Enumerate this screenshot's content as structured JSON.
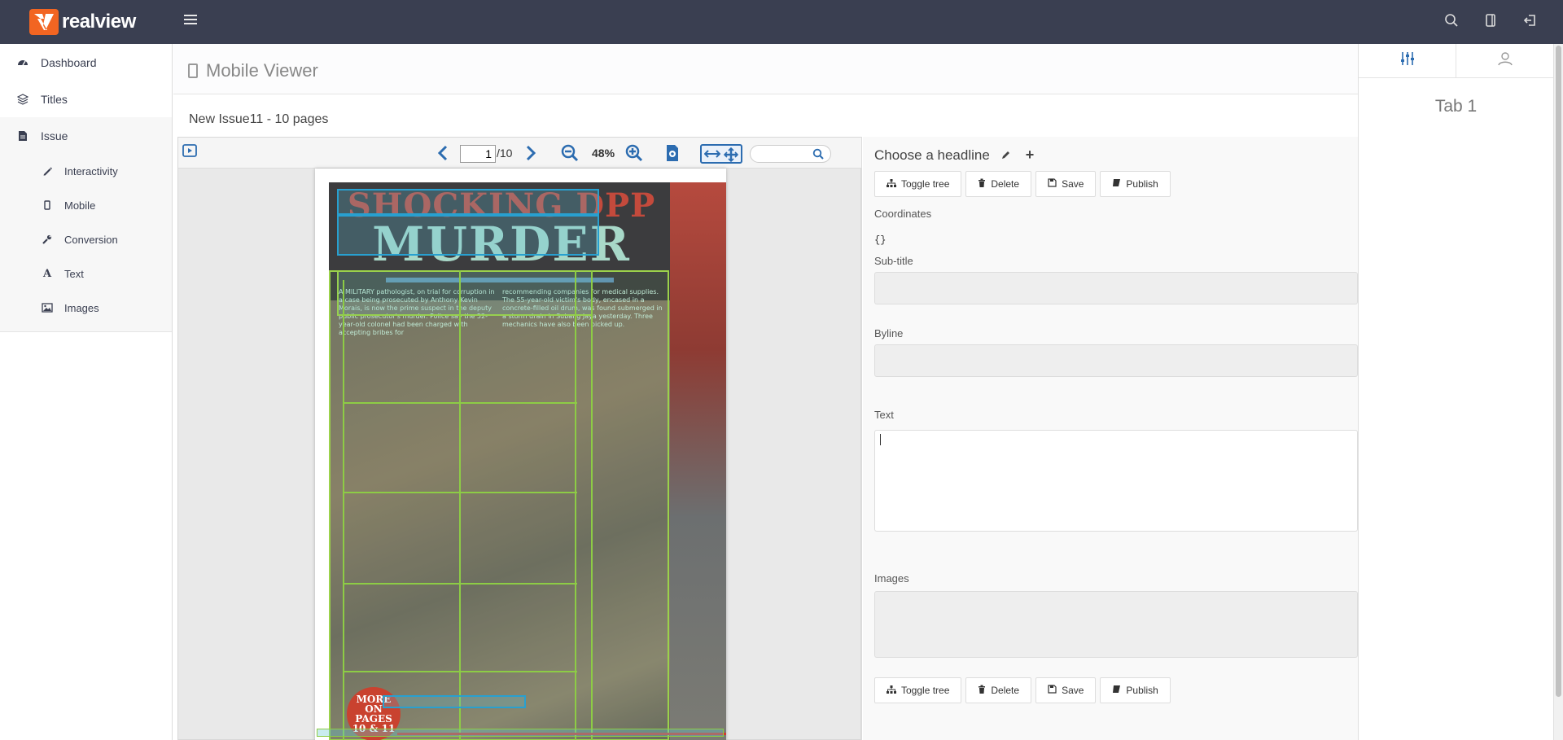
{
  "app": {
    "brand": "realview",
    "brand_color": "#f26522",
    "topbar_color": "#3a3f51"
  },
  "topbar": {
    "icons": [
      "menu-icon",
      "search-icon",
      "tablet-icon",
      "logout-icon"
    ]
  },
  "sidebar": {
    "items": [
      {
        "label": "Dashboard",
        "icon": "dashboard-icon"
      },
      {
        "label": "Titles",
        "icon": "layers-icon"
      },
      {
        "label": "Issue",
        "icon": "document-icon"
      }
    ],
    "sub_items": [
      {
        "label": "Interactivity",
        "icon": "pen-icon"
      },
      {
        "label": "Mobile",
        "icon": "mobile-icon"
      },
      {
        "label": "Conversion",
        "icon": "wrench-icon"
      },
      {
        "label": "Text",
        "icon": "font-icon"
      },
      {
        "label": "Images",
        "icon": "image-icon"
      }
    ]
  },
  "main": {
    "title": "Mobile Viewer",
    "issue_title": "New Issue11 - 10 pages"
  },
  "viewer": {
    "page_current": "1",
    "page_total": "/10",
    "zoom": "48%",
    "search_placeholder": ""
  },
  "page_content": {
    "headline1": "SHOCKING DPP",
    "headline2": "MURDER",
    "col1": "A MILITARY pathologist, on trial for corruption in a case being prosecuted by Anthony Kevin Morais, is now the prime suspect in the deputy public prosecutor's murder. Police say the 52-year-old colonel had been charged with accepting bribes for",
    "col2": "recommending companies for medical supplies. The 55-year-old victim's body, encased in a concrete-filled oil drum, was found submerged in a storm drain in Subang Jaya yesterday. Three mechanics have also been picked up.",
    "badge": [
      "MORE",
      "ON",
      "PAGES",
      "10 & 11"
    ]
  },
  "editor": {
    "title": "Choose a headline",
    "buttons": {
      "toggle_tree": "Toggle tree",
      "delete": "Delete",
      "save": "Save",
      "publish": "Publish"
    },
    "labels": {
      "coordinates": "Coordinates",
      "subtitle": "Sub-title",
      "byline": "Byline",
      "text": "Text",
      "images": "Images"
    },
    "coordinates_value": "{}"
  },
  "right_panel": {
    "tabs": [
      "sliders-icon",
      "user-icon"
    ],
    "content": "Tab 1"
  }
}
